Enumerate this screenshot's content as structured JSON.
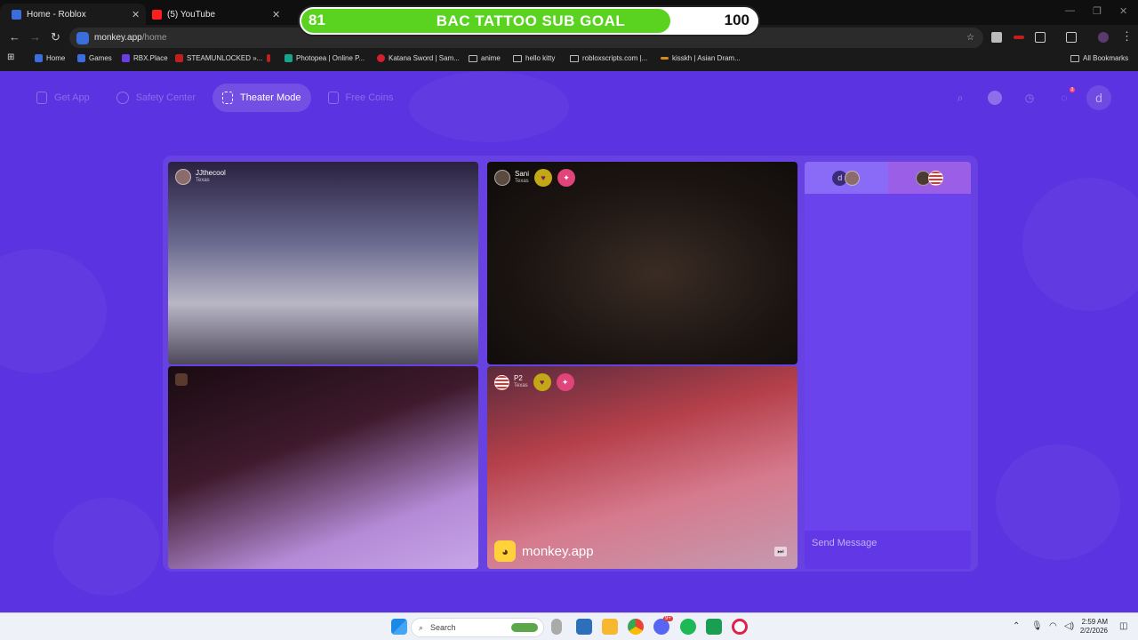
{
  "browser": {
    "tabs": [
      {
        "title": "Home - Roblox",
        "color": "#3b6edc"
      },
      {
        "title": "(5) YouTube",
        "color": "#ff1e1e"
      }
    ],
    "url_host": "monkey.app",
    "url_path": "/home",
    "bookmarks": [
      {
        "label": "Home",
        "icon": "roblox-icon",
        "color": "#3b6edc"
      },
      {
        "label": "Games",
        "icon": "roblox-icon",
        "color": "#3b6edc"
      },
      {
        "label": "RBX.Place",
        "icon": "rbx-icon",
        "color": "#6a3ee0"
      },
      {
        "label": "STEAMUNLOCKED »...",
        "icon": "steam-icon",
        "color": "#c21e1e"
      },
      {
        "label": "",
        "icon": "pin-icon",
        "color": "#c21e1e"
      },
      {
        "label": "Photopea | Online P...",
        "icon": "photopea-icon",
        "color": "#19a38b"
      },
      {
        "label": "Katana Sword | Sam...",
        "icon": "katana-icon",
        "color": "#d61f2e"
      },
      {
        "label": "anime",
        "icon": "folder-icon",
        "color": ""
      },
      {
        "label": "hello kitty",
        "icon": "folder-icon",
        "color": ""
      },
      {
        "label": "robloxscripts.com |...",
        "icon": "folder-icon",
        "color": ""
      },
      {
        "label": "kisskh | Asian Dram...",
        "icon": "kiss-icon",
        "color": "#d98a1f"
      }
    ],
    "all_bookmarks": "All Bookmarks"
  },
  "overlay": {
    "goal_current": "81",
    "goal_title": "BAC TATTOO SUB GOAL",
    "goal_target": "100",
    "progress": 0.81
  },
  "app": {
    "nav": [
      {
        "label": "Get App",
        "icon": "phone-icon",
        "active": false
      },
      {
        "label": "Safety Center",
        "icon": "shield-icon",
        "active": false
      },
      {
        "label": "Theater Mode",
        "icon": "expand-icon",
        "active": true
      },
      {
        "label": "Free Coins",
        "icon": "coins-icon",
        "active": false
      }
    ],
    "notification_count": "1",
    "user_initial": "d",
    "accent": "#5c33e0",
    "videos": [
      {
        "name": "JJthecool",
        "location": "Texas"
      },
      {
        "name": "Sani",
        "location": "Texas"
      },
      {
        "name": "",
        "location": ""
      },
      {
        "name": "P2",
        "location": "Texas"
      }
    ],
    "watermark": "monkey.app",
    "chat": {
      "tab_a_initial": "d",
      "placeholder": "Send Message"
    }
  },
  "taskbar": {
    "search_label": "Search",
    "chat_badge": "9+",
    "time": "2:59 AM",
    "date": "2/2/2026"
  }
}
